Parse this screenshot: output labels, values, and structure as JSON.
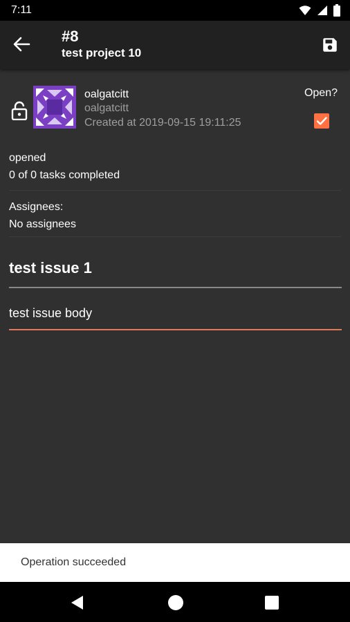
{
  "status_bar": {
    "time": "7:11",
    "icons": [
      "wifi-icon",
      "cellular-icon",
      "battery-icon"
    ]
  },
  "app_bar": {
    "back_icon": "arrow-back-icon",
    "issue_number": "#8",
    "project_name": "test project 10",
    "save_icon": "save-icon"
  },
  "issue": {
    "lock_icon": "lock-open-icon",
    "author_name": "oalgatcitt",
    "author_username": "oalgatcitt",
    "created_at": "Created at 2019-09-15 19:11:25",
    "open_label": "Open?",
    "open_checked": true,
    "state": "opened",
    "tasks": "0 of 0 tasks completed",
    "assignees_label": "Assignees:",
    "assignees_value": "No assignees",
    "title": "test issue 1",
    "body": "test issue body"
  },
  "snackbar": {
    "message": "Operation succeeded"
  },
  "nav_bar": {
    "back": "nav-back-icon",
    "home": "nav-home-icon",
    "recents": "nav-recents-icon"
  },
  "colors": {
    "background": "#303030",
    "app_bar": "#212121",
    "accent": "#ff7043",
    "avatar": "#7b3fc4",
    "secondary_text": "#9e9e9e"
  }
}
